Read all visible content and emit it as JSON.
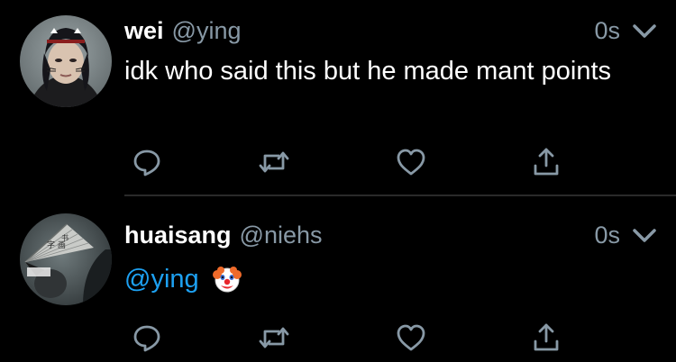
{
  "colors": {
    "background": "#000000",
    "primary_text": "#ffffff",
    "secondary_text": "#8899a6",
    "mention": "#1da1f2",
    "divider": "#2a2a2a"
  },
  "tweets": [
    {
      "name": "wei",
      "handle": "@ying",
      "time": "0s",
      "text": "idk who said this but he made mant points",
      "avatar_icon": "user-avatar-photo",
      "actions": [
        "reply-icon",
        "retweet-icon",
        "like-icon",
        "share-icon"
      ]
    },
    {
      "name": "huaisang",
      "handle": "@niehs",
      "time": "0s",
      "mention": "@ying",
      "emoji_icon": "clown-face-emoji",
      "avatar_icon": "user-avatar-photo-fan",
      "actions": [
        "reply-icon",
        "retweet-icon",
        "like-icon",
        "share-icon"
      ]
    }
  ]
}
